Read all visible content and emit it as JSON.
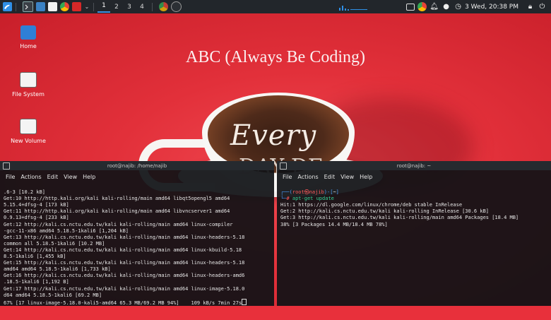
{
  "panel": {
    "workspaces": [
      "1",
      "2",
      "3",
      "4"
    ],
    "active_workspace": "1",
    "clock": "3 Wed, 20:38 PM",
    "launchers": [
      "kali-menu-icon",
      "terminal-icon",
      "folder-icon",
      "text-editor-icon",
      "chrome-icon",
      "flag-icon"
    ],
    "tray_icons": [
      "window-icon",
      "chrome-icon",
      "bell-icon",
      "moon-icon",
      "clock-icon",
      "lock-icon",
      "power-icon"
    ]
  },
  "wallpaper": {
    "title": "ABC (Always Be Coding)",
    "latte_line1": "Every",
    "latte_line2": "DAY DE"
  },
  "desktop_icons": [
    {
      "label": "Home",
      "icon": "home-folder-icon"
    },
    {
      "label": "File System",
      "icon": "drive-icon"
    },
    {
      "label": "New Volume",
      "icon": "drive-icon"
    }
  ],
  "terminal_left": {
    "title": "root@najib: /home/najib",
    "menu": [
      "File",
      "Actions",
      "Edit",
      "View",
      "Help"
    ],
    "lines": [
      ".6-3 [10.2 kB]",
      "Get:10 http://http.kali.org/kali kali-rolling/main amd64 libqt5opengl5 amd64",
      "5.15.4+dfsg-4 [173 kB]",
      "Get:11 http://http.kali.org/kali kali-rolling/main amd64 libvncserver1 amd64",
      "0.9.13+dfsg-4 [233 kB]",
      "Get:12 http://kali.cs.nctu.edu.tw/kali kali-rolling/main amd64 linux-compiler",
      "-gcc-11-x86 amd64 5.18.5-1kali6 [1,204 kB]",
      "Get:13 http://kali.cs.nctu.edu.tw/kali kali-rolling/main amd64 linux-headers-5.18",
      "common all 5.18.5-1kali6 [10.2 MB]",
      "Get:14 http://kali.cs.nctu.edu.tw/kali kali-rolling/main amd64 linux-kbuild-5.18",
      "8.5-1kali6 [1,455 kB]",
      "Get:15 http://kali.cs.nctu.edu.tw/kali kali-rolling/main amd64 linux-headers-5.18",
      "amd64 amd64 5.18.5-1kali6 [1,733 kB]",
      "Get:16 http://kali.cs.nctu.edu.tw/kali kali-rolling/main amd64 linux-headers-amd6",
      ".18.5-1kali6 [1,192 B]",
      "Get:17 http://kali.cs.nctu.edu.tw/kali kali-rolling/main amd64 linux-image-5.18.0",
      "d64 amd64 5.18.5-1kali6 [69.2 MB]"
    ],
    "progress_line": "67% [17 linux-image-5.18.0-kali5-amd64 65.3 MB/69.2 MB 94%]    109 kB/s 7min 27s"
  },
  "terminal_right": {
    "title": "root@najib: ~",
    "menu": [
      "File",
      "Actions",
      "Edit",
      "View",
      "Help"
    ],
    "prompt_user": "root",
    "prompt_host": "najib",
    "prompt_dir": "~",
    "command": "apt-get update",
    "lines": [
      "Hit:1 https://dl.google.com/linux/chrome/deb stable InRelease",
      "Get:2 http://kali.cs.nctu.edu.tw/kali kali-rolling InRelease [30.6 kB]",
      "Get:3 http://kali.cs.nctu.edu.tw/kali kali-rolling/main amd64 Packages [18.4 MB]",
      "38% [3 Packages 14.4 MB/18.4 MB 78%]"
    ]
  }
}
